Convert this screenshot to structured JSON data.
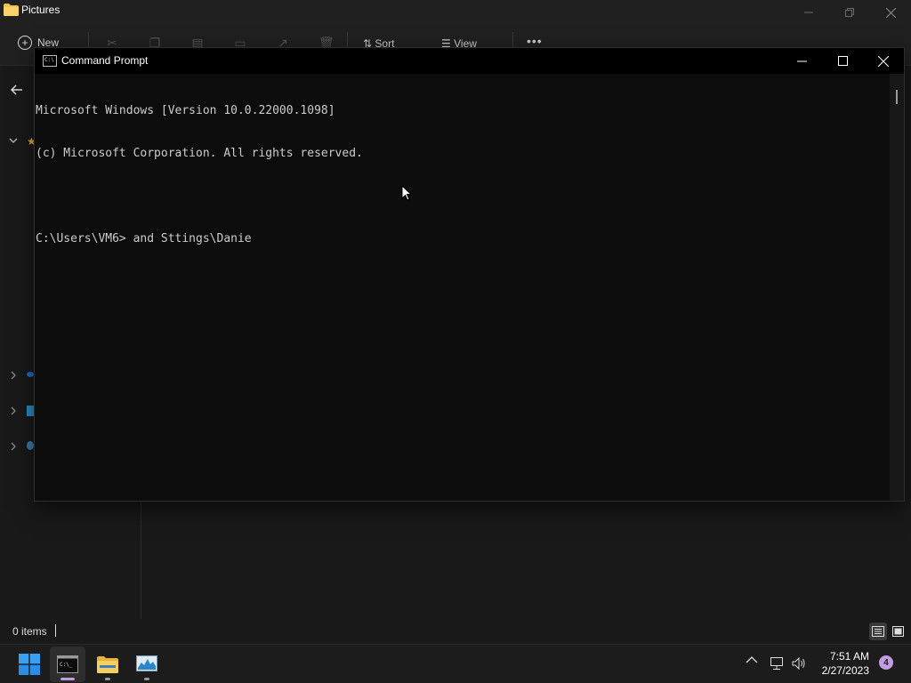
{
  "explorer": {
    "title": "Pictures",
    "toolbar": {
      "new_label": "New",
      "sort_label": "Sort",
      "view_label": "View"
    },
    "status": {
      "items_count": "0 items"
    }
  },
  "cmd": {
    "title": "Command Prompt",
    "lines": [
      "Microsoft Windows [Version 10.0.22000.1098]",
      "(c) Microsoft Corporation. All rights reserved.",
      "",
      "C:\\Users\\VM6> and Sttings\\Danie"
    ]
  },
  "taskbar": {
    "apps": [
      {
        "name": "start",
        "icon": "windows-start-icon"
      },
      {
        "name": "command-prompt",
        "icon": "cmd-icon",
        "active": true
      },
      {
        "name": "file-explorer",
        "icon": "folder-icon"
      },
      {
        "name": "performance-monitor",
        "icon": "perfmon-icon"
      }
    ],
    "clock": {
      "time": "7:51 AM",
      "date": "2/27/2023"
    },
    "notifications_count": "4"
  },
  "colors": {
    "cmd_text": "#cccccc",
    "cmd_background": "#0c0c0c",
    "taskbar_background": "#1c1c1c",
    "accent_indicator": "#c39be3",
    "explorer_background": "#191919"
  }
}
